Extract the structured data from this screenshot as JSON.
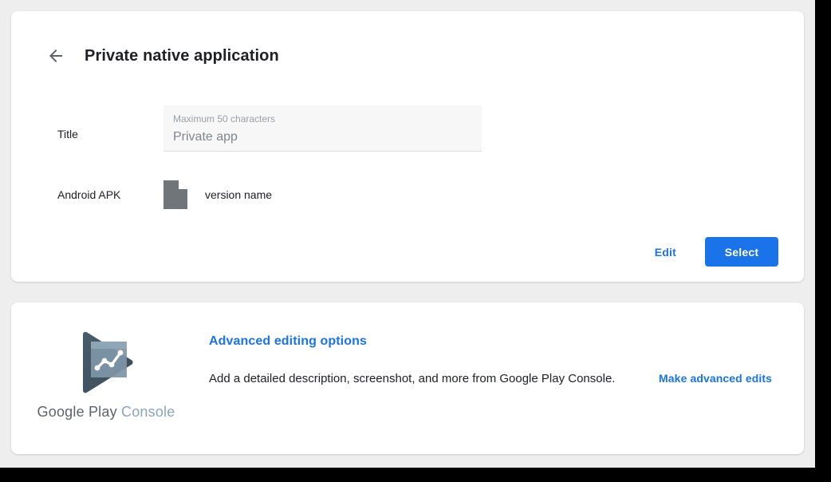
{
  "window": {
    "page_background": "#eeeeee",
    "card_background": "#ffffff",
    "accent_color": "#1a73e8"
  },
  "app_card": {
    "back_icon": "arrow-left-icon",
    "title": "Private native application",
    "title_field": {
      "label": "Title",
      "helper": "Maximum 50 characters",
      "value": "Private app"
    },
    "apk": {
      "label": "Android APK",
      "file_icon": "file-document-icon",
      "version": "version name"
    },
    "actions": {
      "edit_label": "Edit",
      "select_label": "Select"
    }
  },
  "advanced_card": {
    "logo": {
      "icon": "google-play-console-icon",
      "wordmark_primary": "Google Play",
      "wordmark_secondary": "Console"
    },
    "title": "Advanced editing options",
    "description": "Add a detailed description, screenshot, and more from Google Play Console.",
    "link_label": "Make advanced edits"
  }
}
